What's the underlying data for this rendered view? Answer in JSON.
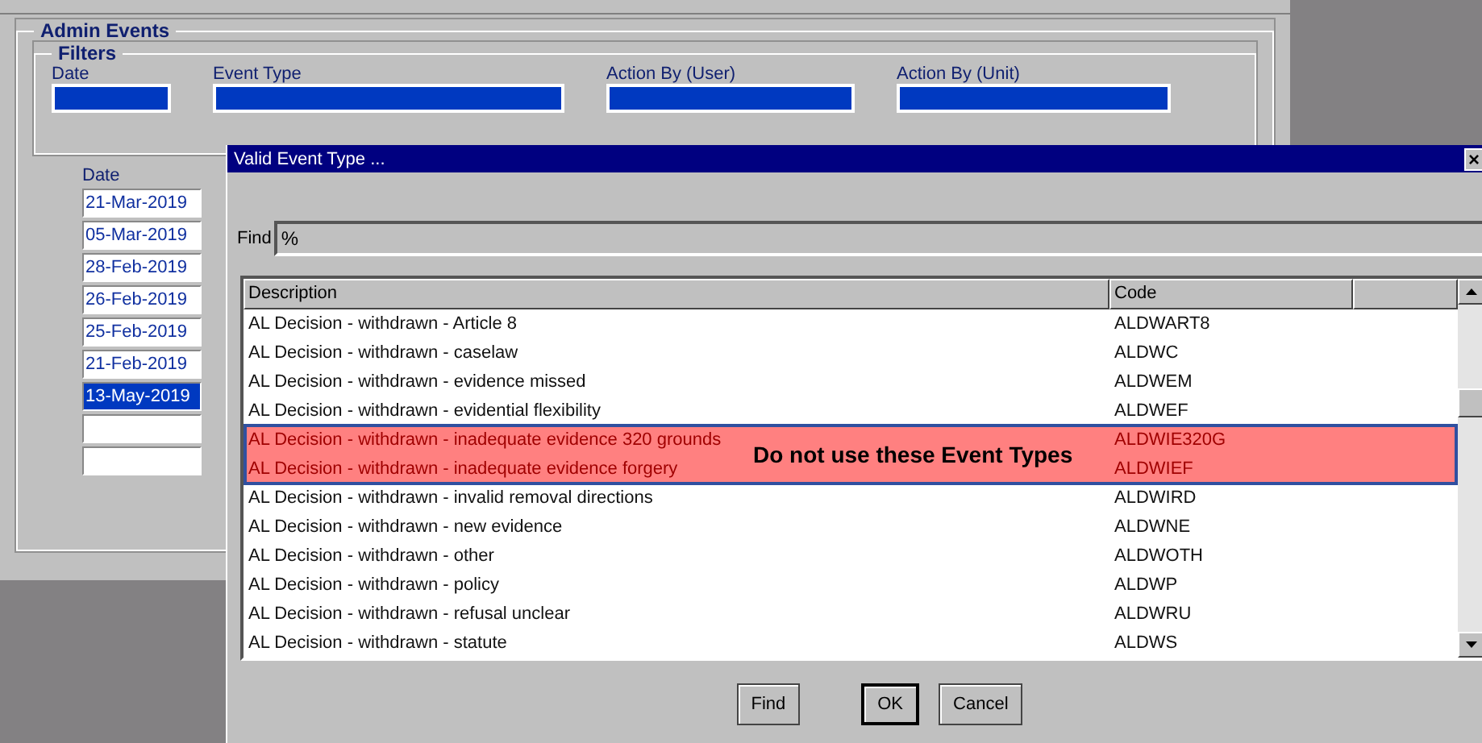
{
  "admin_events": {
    "title": "Admin Events",
    "filters": {
      "title": "Filters",
      "fields": [
        {
          "label": "Date"
        },
        {
          "label": "Event Type"
        },
        {
          "label": "Action By (User)"
        },
        {
          "label": "Action By (Unit)"
        }
      ]
    },
    "date_column": {
      "header": "Date",
      "rows": [
        {
          "value": "21-Mar-2019",
          "selected": false
        },
        {
          "value": "05-Mar-2019",
          "selected": false
        },
        {
          "value": "28-Feb-2019",
          "selected": false
        },
        {
          "value": "26-Feb-2019",
          "selected": false
        },
        {
          "value": "25-Feb-2019",
          "selected": false
        },
        {
          "value": "21-Feb-2019",
          "selected": false
        },
        {
          "value": "13-May-2019",
          "selected": true
        },
        {
          "value": "",
          "selected": false
        },
        {
          "value": "",
          "selected": false
        }
      ]
    }
  },
  "dialog": {
    "title": "Valid Event Type ...",
    "close": "×",
    "find": {
      "label": "Find",
      "value": "%"
    },
    "table": {
      "columns": [
        "Description",
        "Code"
      ],
      "rows": [
        {
          "description": "AL Decision - withdrawn - Article 8",
          "code": "ALDWART8",
          "flagged": false
        },
        {
          "description": "AL Decision - withdrawn - caselaw",
          "code": "ALDWC",
          "flagged": false
        },
        {
          "description": "AL Decision - withdrawn - evidence missed",
          "code": "ALDWEM",
          "flagged": false
        },
        {
          "description": "AL Decision - withdrawn - evidential flexibility",
          "code": "ALDWEF",
          "flagged": false
        },
        {
          "description": "AL Decision - withdrawn - inadequate evidence 320 grounds",
          "code": "ALDWIE320G",
          "flagged": true
        },
        {
          "description": "AL Decision - withdrawn - inadequate evidence forgery",
          "code": "ALDWIEF",
          "flagged": true
        },
        {
          "description": "AL Decision - withdrawn - invalid removal directions",
          "code": "ALDWIRD",
          "flagged": false
        },
        {
          "description": "AL Decision - withdrawn - new evidence",
          "code": "ALDWNE",
          "flagged": false
        },
        {
          "description": "AL Decision - withdrawn - other",
          "code": "ALDWOTH",
          "flagged": false
        },
        {
          "description": "AL Decision - withdrawn - policy",
          "code": "ALDWP",
          "flagged": false
        },
        {
          "description": "AL Decision - withdrawn - refusal unclear",
          "code": "ALDWRU",
          "flagged": false
        },
        {
          "description": "AL Decision - withdrawn - statute",
          "code": "ALDWS",
          "flagged": false
        }
      ]
    },
    "annotation": "Do not use these Event Types",
    "buttons": [
      {
        "label": "Find",
        "default": false
      },
      {
        "label": "OK",
        "default": true
      },
      {
        "label": "Cancel",
        "default": false
      }
    ]
  }
}
